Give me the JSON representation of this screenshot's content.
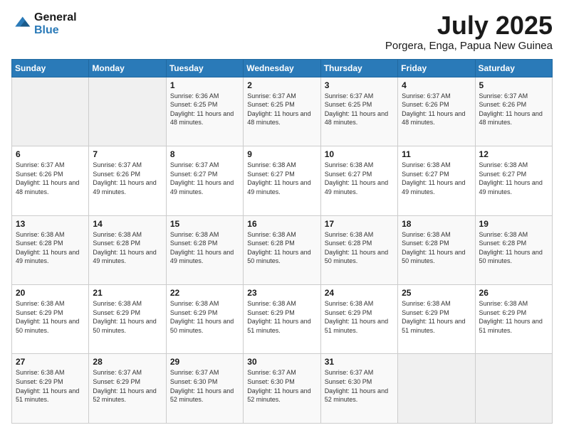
{
  "header": {
    "logo_line1": "General",
    "logo_line2": "Blue",
    "title": "July 2025",
    "subtitle": "Porgera, Enga, Papua New Guinea"
  },
  "calendar": {
    "days_of_week": [
      "Sunday",
      "Monday",
      "Tuesday",
      "Wednesday",
      "Thursday",
      "Friday",
      "Saturday"
    ],
    "weeks": [
      [
        {
          "day": "",
          "detail": ""
        },
        {
          "day": "",
          "detail": ""
        },
        {
          "day": "1",
          "detail": "Sunrise: 6:36 AM\nSunset: 6:25 PM\nDaylight: 11 hours and 48 minutes."
        },
        {
          "day": "2",
          "detail": "Sunrise: 6:37 AM\nSunset: 6:25 PM\nDaylight: 11 hours and 48 minutes."
        },
        {
          "day": "3",
          "detail": "Sunrise: 6:37 AM\nSunset: 6:25 PM\nDaylight: 11 hours and 48 minutes."
        },
        {
          "day": "4",
          "detail": "Sunrise: 6:37 AM\nSunset: 6:26 PM\nDaylight: 11 hours and 48 minutes."
        },
        {
          "day": "5",
          "detail": "Sunrise: 6:37 AM\nSunset: 6:26 PM\nDaylight: 11 hours and 48 minutes."
        }
      ],
      [
        {
          "day": "6",
          "detail": "Sunrise: 6:37 AM\nSunset: 6:26 PM\nDaylight: 11 hours and 48 minutes."
        },
        {
          "day": "7",
          "detail": "Sunrise: 6:37 AM\nSunset: 6:26 PM\nDaylight: 11 hours and 49 minutes."
        },
        {
          "day": "8",
          "detail": "Sunrise: 6:37 AM\nSunset: 6:27 PM\nDaylight: 11 hours and 49 minutes."
        },
        {
          "day": "9",
          "detail": "Sunrise: 6:38 AM\nSunset: 6:27 PM\nDaylight: 11 hours and 49 minutes."
        },
        {
          "day": "10",
          "detail": "Sunrise: 6:38 AM\nSunset: 6:27 PM\nDaylight: 11 hours and 49 minutes."
        },
        {
          "day": "11",
          "detail": "Sunrise: 6:38 AM\nSunset: 6:27 PM\nDaylight: 11 hours and 49 minutes."
        },
        {
          "day": "12",
          "detail": "Sunrise: 6:38 AM\nSunset: 6:27 PM\nDaylight: 11 hours and 49 minutes."
        }
      ],
      [
        {
          "day": "13",
          "detail": "Sunrise: 6:38 AM\nSunset: 6:28 PM\nDaylight: 11 hours and 49 minutes."
        },
        {
          "day": "14",
          "detail": "Sunrise: 6:38 AM\nSunset: 6:28 PM\nDaylight: 11 hours and 49 minutes."
        },
        {
          "day": "15",
          "detail": "Sunrise: 6:38 AM\nSunset: 6:28 PM\nDaylight: 11 hours and 49 minutes."
        },
        {
          "day": "16",
          "detail": "Sunrise: 6:38 AM\nSunset: 6:28 PM\nDaylight: 11 hours and 50 minutes."
        },
        {
          "day": "17",
          "detail": "Sunrise: 6:38 AM\nSunset: 6:28 PM\nDaylight: 11 hours and 50 minutes."
        },
        {
          "day": "18",
          "detail": "Sunrise: 6:38 AM\nSunset: 6:28 PM\nDaylight: 11 hours and 50 minutes."
        },
        {
          "day": "19",
          "detail": "Sunrise: 6:38 AM\nSunset: 6:28 PM\nDaylight: 11 hours and 50 minutes."
        }
      ],
      [
        {
          "day": "20",
          "detail": "Sunrise: 6:38 AM\nSunset: 6:29 PM\nDaylight: 11 hours and 50 minutes."
        },
        {
          "day": "21",
          "detail": "Sunrise: 6:38 AM\nSunset: 6:29 PM\nDaylight: 11 hours and 50 minutes."
        },
        {
          "day": "22",
          "detail": "Sunrise: 6:38 AM\nSunset: 6:29 PM\nDaylight: 11 hours and 50 minutes."
        },
        {
          "day": "23",
          "detail": "Sunrise: 6:38 AM\nSunset: 6:29 PM\nDaylight: 11 hours and 51 minutes."
        },
        {
          "day": "24",
          "detail": "Sunrise: 6:38 AM\nSunset: 6:29 PM\nDaylight: 11 hours and 51 minutes."
        },
        {
          "day": "25",
          "detail": "Sunrise: 6:38 AM\nSunset: 6:29 PM\nDaylight: 11 hours and 51 minutes."
        },
        {
          "day": "26",
          "detail": "Sunrise: 6:38 AM\nSunset: 6:29 PM\nDaylight: 11 hours and 51 minutes."
        }
      ],
      [
        {
          "day": "27",
          "detail": "Sunrise: 6:38 AM\nSunset: 6:29 PM\nDaylight: 11 hours and 51 minutes."
        },
        {
          "day": "28",
          "detail": "Sunrise: 6:37 AM\nSunset: 6:29 PM\nDaylight: 11 hours and 52 minutes."
        },
        {
          "day": "29",
          "detail": "Sunrise: 6:37 AM\nSunset: 6:30 PM\nDaylight: 11 hours and 52 minutes."
        },
        {
          "day": "30",
          "detail": "Sunrise: 6:37 AM\nSunset: 6:30 PM\nDaylight: 11 hours and 52 minutes."
        },
        {
          "day": "31",
          "detail": "Sunrise: 6:37 AM\nSunset: 6:30 PM\nDaylight: 11 hours and 52 minutes."
        },
        {
          "day": "",
          "detail": ""
        },
        {
          "day": "",
          "detail": ""
        }
      ]
    ]
  }
}
